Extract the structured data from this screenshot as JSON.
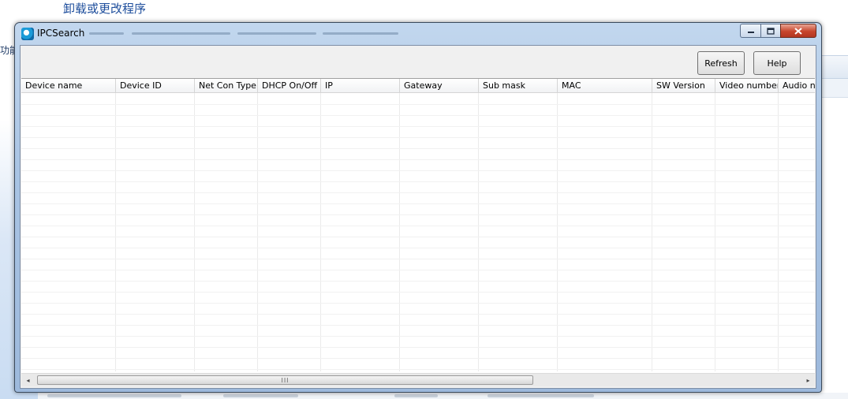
{
  "background": {
    "heading": "卸载或更改程序",
    "side_fragment": "功能"
  },
  "window": {
    "title": "IPCSearch",
    "app_icon": "ipcsearch-logo-icon",
    "caption_buttons": {
      "minimize": "minimize-icon",
      "maximize": "maximize-icon",
      "close": "close-icon"
    }
  },
  "toolbar": {
    "refresh_label": "Refresh",
    "help_label": "Help"
  },
  "device_list": {
    "columns": [
      "Device name",
      "Device ID",
      "Net Con Type",
      "DHCP On/Off",
      "IP",
      "Gateway",
      "Sub mask",
      "MAC",
      "SW Version",
      "Video number",
      "Audio nu"
    ],
    "rows": []
  },
  "scrollbar": {
    "left_arrow": "◂",
    "right_arrow": "▸",
    "grip": "III"
  }
}
